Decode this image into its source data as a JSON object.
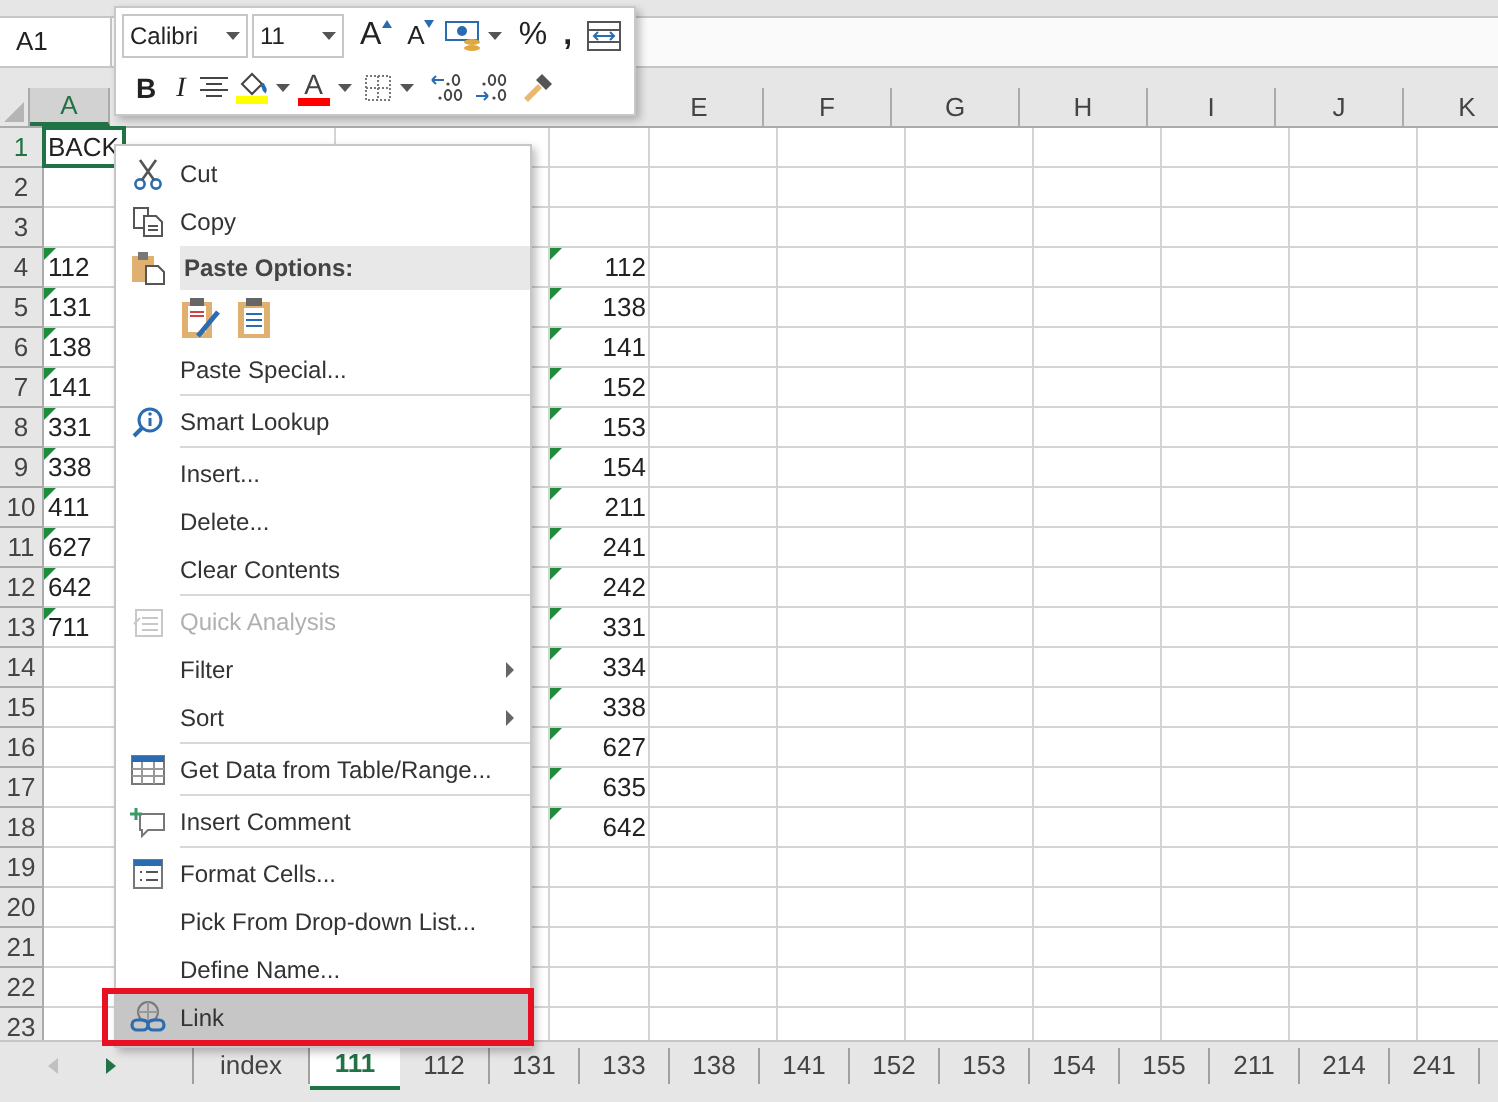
{
  "name_box": {
    "value": "A1"
  },
  "mini_toolbar": {
    "font": "Calibri",
    "size": "11",
    "grow_font": "A",
    "shrink_font": "A",
    "percent": "%",
    "comma": ",",
    "bold": "B",
    "italic": "I",
    "font_color_letter": "A"
  },
  "columns": [
    {
      "label": "A"
    },
    {},
    {},
    {},
    {
      "label": "E"
    },
    {
      "label": "F"
    },
    {
      "label": "G"
    },
    {
      "label": "H"
    },
    {
      "label": "I"
    },
    {
      "label": "J"
    },
    {
      "label": "K"
    }
  ],
  "rows": [
    {
      "number": "1",
      "cells": [
        {
          "text": "BACK",
          "selected": true,
          "flag": false
        }
      ]
    },
    {
      "number": "2",
      "cells": []
    },
    {
      "number": "3",
      "cells": []
    },
    {
      "number": "4",
      "cells": [
        {
          "text": "112",
          "selected": false,
          "flag": true
        },
        {},
        {},
        {
          "text": "112",
          "selected": false,
          "flag": true
        }
      ]
    },
    {
      "number": "5",
      "cells": [
        {
          "text": "131",
          "selected": false,
          "flag": true
        },
        {},
        {},
        {
          "text": "138",
          "selected": false,
          "flag": true
        }
      ]
    },
    {
      "number": "6",
      "cells": [
        {
          "text": "138",
          "selected": false,
          "flag": true
        },
        {},
        {},
        {
          "text": "141",
          "selected": false,
          "flag": true
        }
      ]
    },
    {
      "number": "7",
      "cells": [
        {
          "text": "141",
          "selected": false,
          "flag": true
        },
        {},
        {},
        {
          "text": "152",
          "selected": false,
          "flag": true
        }
      ]
    },
    {
      "number": "8",
      "cells": [
        {
          "text": "331",
          "selected": false,
          "flag": true
        },
        {},
        {},
        {
          "text": "153",
          "selected": false,
          "flag": true
        }
      ]
    },
    {
      "number": "9",
      "cells": [
        {
          "text": "338",
          "selected": false,
          "flag": true
        },
        {},
        {},
        {
          "text": "154",
          "selected": false,
          "flag": true
        }
      ]
    },
    {
      "number": "10",
      "cells": [
        {
          "text": "411",
          "selected": false,
          "flag": true
        },
        {},
        {},
        {
          "text": "211",
          "selected": false,
          "flag": true
        }
      ]
    },
    {
      "number": "11",
      "cells": [
        {
          "text": "627",
          "selected": false,
          "flag": true
        },
        {},
        {},
        {
          "text": "241",
          "selected": false,
          "flag": true
        }
      ]
    },
    {
      "number": "12",
      "cells": [
        {
          "text": "642",
          "selected": false,
          "flag": true
        },
        {},
        {},
        {
          "text": "242",
          "selected": false,
          "flag": true
        }
      ]
    },
    {
      "number": "13",
      "cells": [
        {
          "text": "711",
          "selected": false,
          "flag": true
        },
        {},
        {},
        {
          "text": "331",
          "selected": false,
          "flag": true
        }
      ]
    },
    {
      "number": "14",
      "cells": [
        {},
        {},
        {},
        {
          "text": "334",
          "selected": false,
          "flag": true
        }
      ]
    },
    {
      "number": "15",
      "cells": [
        {},
        {},
        {},
        {
          "text": "338",
          "selected": false,
          "flag": true
        }
      ]
    },
    {
      "number": "16",
      "cells": [
        {},
        {},
        {},
        {
          "text": "627",
          "selected": false,
          "flag": true
        }
      ]
    },
    {
      "number": "17",
      "cells": [
        {},
        {},
        {},
        {
          "text": "635",
          "selected": false,
          "flag": true
        }
      ]
    },
    {
      "number": "18",
      "cells": [
        {},
        {},
        {},
        {
          "text": "642",
          "selected": false,
          "flag": true
        }
      ]
    },
    {
      "number": "19",
      "cells": []
    },
    {
      "number": "20",
      "cells": []
    },
    {
      "number": "21",
      "cells": []
    },
    {
      "number": "22",
      "cells": []
    },
    {
      "number": "23",
      "cells": []
    }
  ],
  "menu": {
    "items": [
      {
        "kind": "item",
        "label": "Cut",
        "disabled": false,
        "submenu": false,
        "highlighted": false,
        "outlined": false
      },
      {
        "kind": "item",
        "label": "Copy",
        "disabled": false,
        "submenu": false,
        "highlighted": false,
        "outlined": false
      },
      {
        "kind": "header",
        "label": "Paste Options:"
      },
      {
        "kind": "paste_options"
      },
      {
        "kind": "item",
        "label": "Paste Special...",
        "disabled": false,
        "submenu": false,
        "highlighted": false,
        "outlined": false
      },
      {
        "kind": "separator"
      },
      {
        "kind": "item",
        "label": "Smart Lookup",
        "disabled": false,
        "submenu": false,
        "highlighted": false,
        "outlined": false
      },
      {
        "kind": "separator"
      },
      {
        "kind": "item",
        "label": "Insert...",
        "disabled": false,
        "submenu": false,
        "highlighted": false,
        "outlined": false
      },
      {
        "kind": "item",
        "label": "Delete...",
        "disabled": false,
        "submenu": false,
        "highlighted": false,
        "outlined": false
      },
      {
        "kind": "item",
        "label": "Clear Contents",
        "disabled": false,
        "submenu": false,
        "highlighted": false,
        "outlined": false
      },
      {
        "kind": "separator"
      },
      {
        "kind": "item",
        "label": "Quick Analysis",
        "disabled": true,
        "submenu": false,
        "highlighted": false,
        "outlined": false
      },
      {
        "kind": "item",
        "label": "Filter",
        "disabled": false,
        "submenu": true,
        "highlighted": false,
        "outlined": false
      },
      {
        "kind": "item",
        "label": "Sort",
        "disabled": false,
        "submenu": true,
        "highlighted": false,
        "outlined": false
      },
      {
        "kind": "separator"
      },
      {
        "kind": "item",
        "label": "Get Data from Table/Range...",
        "disabled": false,
        "submenu": false,
        "highlighted": false,
        "outlined": false
      },
      {
        "kind": "separator"
      },
      {
        "kind": "item",
        "label": "Insert Comment",
        "disabled": false,
        "submenu": false,
        "highlighted": false,
        "outlined": false
      },
      {
        "kind": "separator"
      },
      {
        "kind": "item",
        "label": "Format Cells...",
        "disabled": false,
        "submenu": false,
        "highlighted": false,
        "outlined": false
      },
      {
        "kind": "item",
        "label": "Pick From Drop-down List...",
        "disabled": false,
        "submenu": false,
        "highlighted": false,
        "outlined": false
      },
      {
        "kind": "item",
        "label": "Define Name...",
        "disabled": false,
        "submenu": false,
        "highlighted": false,
        "outlined": false
      },
      {
        "kind": "item",
        "label": "Link",
        "disabled": false,
        "submenu": false,
        "highlighted": true,
        "outlined": true
      }
    ]
  },
  "sheet_tabs": [
    {
      "label": "index",
      "selected": false
    },
    {
      "label": "111",
      "selected": true
    },
    {
      "label": "112",
      "selected": false
    },
    {
      "label": "131",
      "selected": false
    },
    {
      "label": "133",
      "selected": false
    },
    {
      "label": "138",
      "selected": false
    },
    {
      "label": "141",
      "selected": false
    },
    {
      "label": "152",
      "selected": false
    },
    {
      "label": "153",
      "selected": false
    },
    {
      "label": "154",
      "selected": false
    },
    {
      "label": "155",
      "selected": false
    },
    {
      "label": "211",
      "selected": false
    },
    {
      "label": "214",
      "selected": false
    },
    {
      "label": "241",
      "selected": false
    }
  ]
}
